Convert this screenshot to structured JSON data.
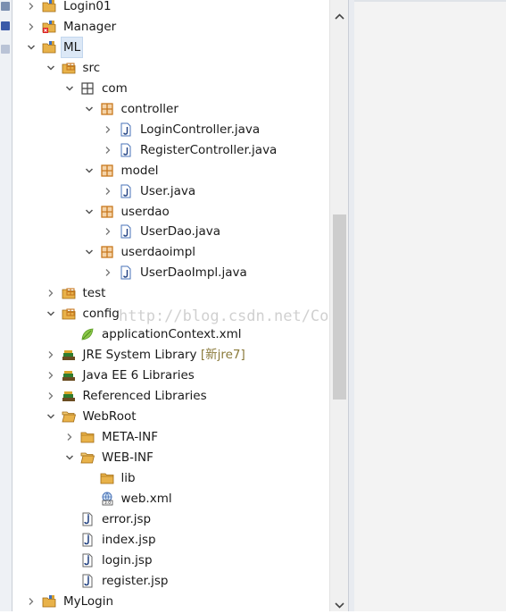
{
  "tree": [
    {
      "label": "Login01",
      "level": 0,
      "state": "collapsed",
      "icon": "java-project-icon"
    },
    {
      "label": "Manager",
      "level": 0,
      "state": "collapsed",
      "icon": "java-project-error-icon"
    },
    {
      "label": "ML",
      "level": 0,
      "state": "expanded",
      "icon": "java-project-icon",
      "selected": true
    },
    {
      "label": "src",
      "level": 1,
      "state": "expanded",
      "icon": "source-folder-icon"
    },
    {
      "label": "com",
      "level": 2,
      "state": "expanded",
      "icon": "package-empty-icon"
    },
    {
      "label": "controller",
      "level": 3,
      "state": "expanded",
      "icon": "package-icon"
    },
    {
      "label": "LoginController.java",
      "level": 4,
      "state": "collapsed",
      "icon": "java-file-icon"
    },
    {
      "label": "RegisterController.java",
      "level": 4,
      "state": "collapsed",
      "icon": "java-file-icon"
    },
    {
      "label": "model",
      "level": 3,
      "state": "expanded",
      "icon": "package-icon"
    },
    {
      "label": "User.java",
      "level": 4,
      "state": "collapsed",
      "icon": "java-file-icon"
    },
    {
      "label": "userdao",
      "level": 3,
      "state": "expanded",
      "icon": "package-icon"
    },
    {
      "label": "UserDao.java",
      "level": 4,
      "state": "collapsed",
      "icon": "java-file-icon"
    },
    {
      "label": "userdaoimpl",
      "level": 3,
      "state": "expanded",
      "icon": "package-icon"
    },
    {
      "label": "UserDaoImpl.java",
      "level": 4,
      "state": "collapsed",
      "icon": "java-file-icon"
    },
    {
      "label": "test",
      "level": 1,
      "state": "collapsed",
      "icon": "source-folder-icon"
    },
    {
      "label": "config",
      "level": 1,
      "state": "expanded",
      "icon": "source-folder-icon"
    },
    {
      "label": "applicationContext.xml",
      "level": 2,
      "state": "leaf",
      "icon": "xml-leaf-icon"
    },
    {
      "label": "JRE System Library",
      "decoration": "[新jre7]",
      "level": 1,
      "state": "collapsed",
      "icon": "library-icon"
    },
    {
      "label": "Java EE 6 Libraries",
      "level": 1,
      "state": "collapsed",
      "icon": "library-icon"
    },
    {
      "label": "Referenced Libraries",
      "level": 1,
      "state": "collapsed",
      "icon": "library-icon"
    },
    {
      "label": "WebRoot",
      "level": 1,
      "state": "expanded",
      "icon": "folder-open-icon"
    },
    {
      "label": "META-INF",
      "level": 2,
      "state": "collapsed",
      "icon": "folder-icon"
    },
    {
      "label": "WEB-INF",
      "level": 2,
      "state": "expanded",
      "icon": "folder-open-icon"
    },
    {
      "label": "lib",
      "level": 3,
      "state": "leaf",
      "icon": "folder-icon"
    },
    {
      "label": "web.xml",
      "level": 3,
      "state": "leaf",
      "icon": "web-xml-icon"
    },
    {
      "label": "error.jsp",
      "level": 2,
      "state": "leaf",
      "icon": "jsp-file-icon"
    },
    {
      "label": "index.jsp",
      "level": 2,
      "state": "leaf",
      "icon": "jsp-file-icon"
    },
    {
      "label": "login.jsp",
      "level": 2,
      "state": "leaf",
      "icon": "jsp-file-icon"
    },
    {
      "label": "register.jsp",
      "level": 2,
      "state": "leaf",
      "icon": "jsp-file-icon"
    },
    {
      "label": "MyLogin",
      "level": 0,
      "state": "collapsed",
      "icon": "java-project-icon"
    }
  ],
  "watermark": "http://blog.csdn.net/Coder_py",
  "scrollbar": {
    "up_icon": "chevron-up-icon",
    "down_icon": "chevron-down-icon"
  },
  "colors": {
    "selection": "#dce8f6",
    "package": "#c8781e",
    "folder": "#e8b24a",
    "java_file": "#4a73b8",
    "library": "#6b4d22",
    "scroll_thumb": "#cdcdcd"
  }
}
